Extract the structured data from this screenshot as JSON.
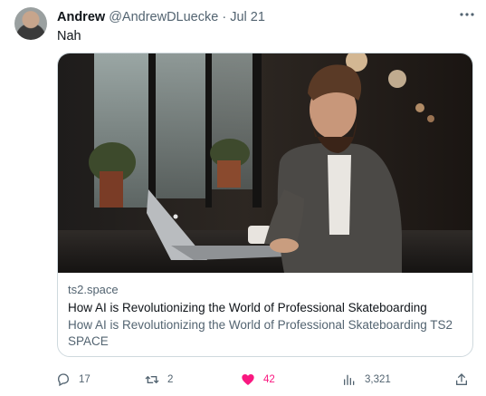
{
  "tweet": {
    "author_name": "Andrew",
    "author_handle": "@AndrewDLuecke",
    "separator": "·",
    "date": "Jul 21",
    "text": "Nah",
    "more_icon": "ellipsis-icon"
  },
  "card": {
    "image_icon": "photo-man-laptop-cafe",
    "domain": "ts2.space",
    "title": "How AI is Revolutionizing the World of Professional Skateboarding",
    "description": "How AI is Revolutionizing the World of Professional Skateboarding TS2 SPACE"
  },
  "actions": {
    "replies": "17",
    "retweets": "2",
    "likes": "42",
    "views": "3,321",
    "like_color": "#f91880"
  }
}
